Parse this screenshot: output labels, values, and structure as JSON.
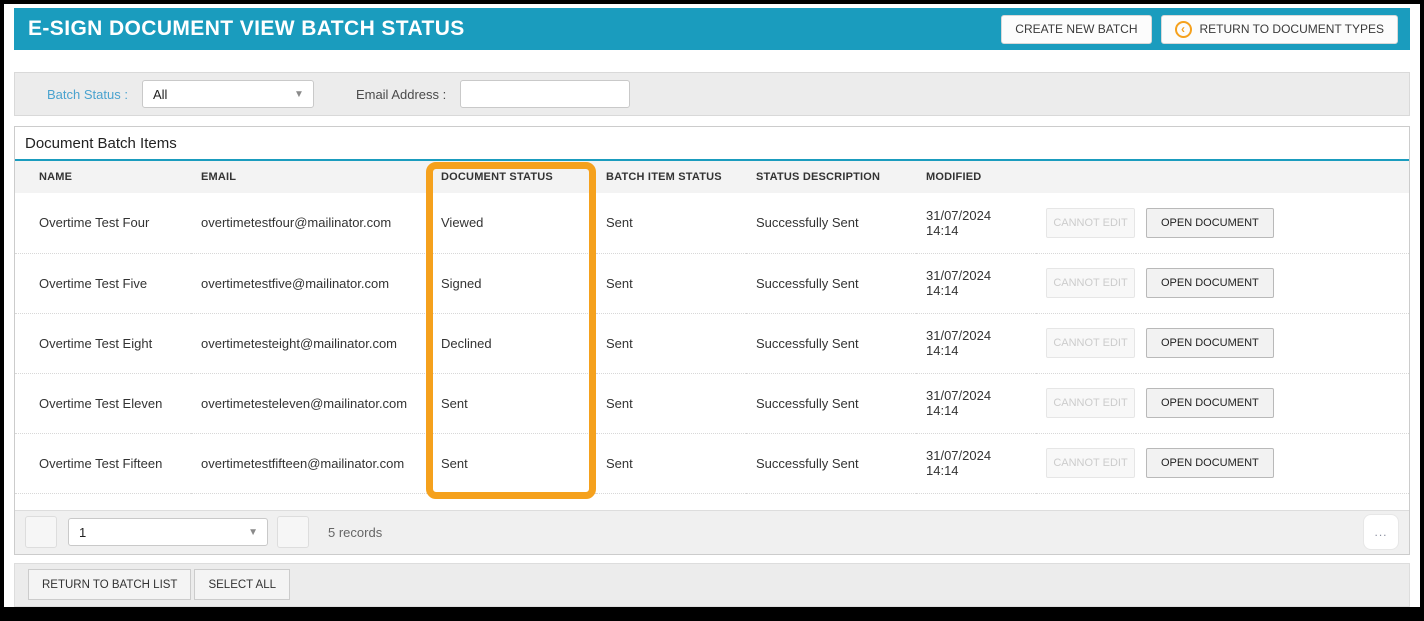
{
  "colors": {
    "accent": "#1a9cbe",
    "highlight": "#f5a11d",
    "link": "#4aa3cf"
  },
  "header": {
    "title": "E-SIGN DOCUMENT VIEW BATCH STATUS",
    "create_new_batch_label": "CREATE NEW BATCH",
    "return_to_document_types_label": "RETURN TO DOCUMENT TYPES",
    "return_icon": "chevron-left-circle"
  },
  "filters": {
    "batch_status_label": "Batch Status :",
    "batch_status_value": "All",
    "email_address_label": "Email Address :",
    "email_address_value": ""
  },
  "panel": {
    "title": "Document Batch Items"
  },
  "table": {
    "columns": [
      "NAME",
      "EMAIL",
      "DOCUMENT STATUS",
      "BATCH ITEM STATUS",
      "STATUS DESCRIPTION",
      "MODIFIED",
      "",
      ""
    ],
    "cannot_edit_label": "CANNOT EDIT",
    "open_document_label": "OPEN DOCUMENT",
    "rows": [
      {
        "name": "Overtime Test Four",
        "email": "overtimetestfour@mailinator.com",
        "document_status": "Viewed",
        "batch_item_status": "Sent",
        "status_description": "Successfully Sent",
        "modified": "31/07/2024 14:14"
      },
      {
        "name": "Overtime Test Five",
        "email": "overtimetestfive@mailinator.com",
        "document_status": "Signed",
        "batch_item_status": "Sent",
        "status_description": "Successfully Sent",
        "modified": "31/07/2024 14:14"
      },
      {
        "name": "Overtime Test Eight",
        "email": "overtimetesteight@mailinator.com",
        "document_status": "Declined",
        "batch_item_status": "Sent",
        "status_description": "Successfully Sent",
        "modified": "31/07/2024 14:14"
      },
      {
        "name": "Overtime Test Eleven",
        "email": "overtimetesteleven@mailinator.com",
        "document_status": "Sent",
        "batch_item_status": "Sent",
        "status_description": "Successfully Sent",
        "modified": "31/07/2024 14:14"
      },
      {
        "name": "Overtime Test Fifteen",
        "email": "overtimetestfifteen@mailinator.com",
        "document_status": "Sent",
        "batch_item_status": "Sent",
        "status_description": "Successfully Sent",
        "modified": "31/07/2024 14:14"
      }
    ]
  },
  "pagination": {
    "page_value": "1",
    "records_text": "5 records",
    "ellipsis_label": "..."
  },
  "footer": {
    "return_to_batch_list_label": "RETURN TO BATCH LIST",
    "select_all_label": "SELECT ALL"
  }
}
